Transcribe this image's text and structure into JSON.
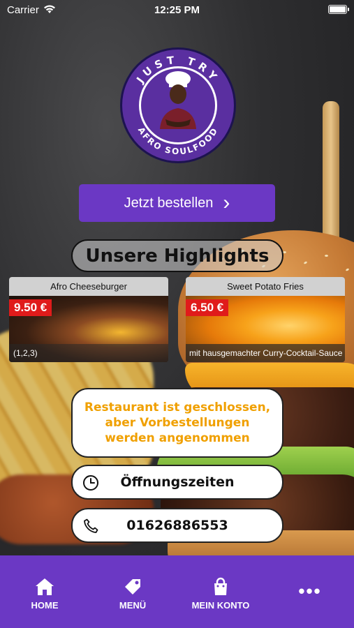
{
  "status_bar": {
    "carrier": "Carrier",
    "time": "12:25 PM",
    "battery_level": 1.0
  },
  "logo": {
    "top_text": "JUST TRY",
    "bottom_text": "AFRO SOULFOOD",
    "ring_color": "#5a2fa0",
    "chef_icon": "chef-icon"
  },
  "order_button": {
    "label": "Jetzt bestellen",
    "chevron": "›",
    "color": "#6b38c4"
  },
  "highlights": {
    "title": "Unsere Highlights",
    "items": [
      {
        "name": "Afro Cheeseburger",
        "price": "9.50 €",
        "footer": "(1,2,3)"
      },
      {
        "name": "Sweet Potato Fries",
        "price": "6.50 €",
        "footer": "mit hausgemachter Curry-Cocktail-Sauce"
      }
    ]
  },
  "notice": {
    "text": "Restaurant ist geschlossen, aber Vorbestellungen werden angenommen",
    "color": "#f0a000"
  },
  "buttons": {
    "hours_label": "Öffnungszeiten",
    "hours_icon": "clock-icon",
    "phone_label": "01626886553",
    "phone_icon": "phone-icon"
  },
  "tabbar": {
    "color": "#6b38c4",
    "tabs": [
      {
        "label": "HOME",
        "icon": "home-icon"
      },
      {
        "label": "MENÜ",
        "icon": "tag-icon"
      },
      {
        "label": "MEIN KONTO",
        "icon": "bag-icon"
      },
      {
        "label": "•••",
        "icon": "more-icon"
      }
    ]
  }
}
